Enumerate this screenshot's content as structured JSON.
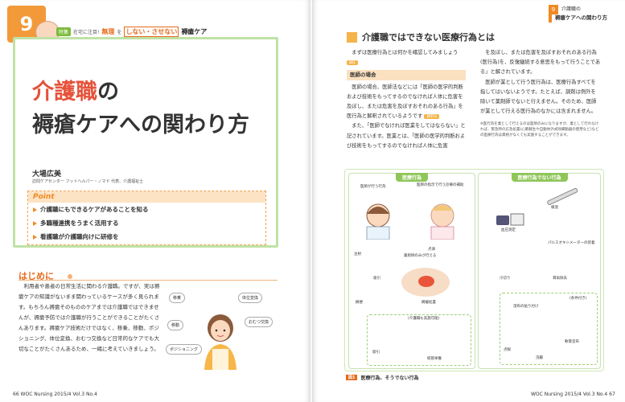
{
  "left": {
    "badge_number": "9",
    "topbar": {
      "tag": "特集",
      "small": "在宅に注目!",
      "em": "無理",
      "mid": "を",
      "u": "しない・させない",
      "main": "褥瘡ケア"
    },
    "title_line1_orange": "介護職",
    "title_line1_rest": "の",
    "title_line2": "褥瘡ケアへの関わり方",
    "author": "大場広美",
    "affiliation": "訪問ケアセンター フットヘルパー・ノマド 代表、介護福祉士",
    "point_header": "Point",
    "points": [
      "介護職にもできるケアがあることを知る",
      "多職種連携をうまく活用する",
      "看護職が介護職向けに研修を"
    ],
    "section_heading": "はじめに",
    "body": "利用者や患者の日常生活に関わる介護職。ですが、実は褥瘡ケアの知識がないまま関わっているケースが多く見られます。もちろん褥瘡そのもののケアまでは介護職ではできませんが、褥瘡予防では介護職が行うことができることがたくさんあります。褥瘡ケア技術だけではなく、移乗、移動、ポジショニング、体位変換、おむつ交換など日常的なケアでも大切なことがたくさんあるため、一緒に考えていきましょう。",
    "bubbles": [
      "移乗",
      "体位変換",
      "移動",
      "おむつ交換",
      "ポジショニング"
    ],
    "footer": "66   WOC Nursing  2015/4 Vol.3 No.4"
  },
  "right": {
    "tab_number": "9",
    "tab_line1": "介護職の",
    "tab_line2": "褥瘡ケアへの関わり方",
    "section_title": "介護職ではできない医療行為とは",
    "col1_p1": "まずは医療行為とは何かを確認してみましょう",
    "col1_tag1": "図1",
    "col1_subhead": "医師の場合",
    "col1_p2": "医師の場合、医師法などには「医師の医学的判断および技術をもってするのでなければ人体に危害を及ぼし、または危害を及ぼすおそれのある行為」を医行為と解釈されているようです",
    "col1_tag2": "資料1",
    "col1_p3": "また、「医師でなければ医業をしてはならない」と記されています。医業とは、「医師の医学的判断および技術をもってするのでなければ人体に危害",
    "col2_p1": "を及ぼし、または危害を及ぼすおそれのある行為(医行為)を、反復継続する意思をもって行うことである」と解されています。",
    "col2_p2": "医師が業として行う医行為は、医療行為すべてを指してはいないようです。たとえば、調剤は例外を除いて薬剤師でないと行えません。そのため、医師が業として行える医行為のなかには含まれません。",
    "col2_note": "※医行為を業として行えるのは医師のみになりますが、業として行わなければ、緊急時の応急処置(心肺蘇生や自動体外式除細動器の使用など)などの医療行為は資格がなくても実施することができます。",
    "figure": {
      "left_header": "医療行為",
      "right_header": "医療行為でない行為",
      "labels_left": [
        "医師が行う行為",
        "医師の指示で行う診療の補助",
        "薬剤師のみが行える",
        "摘便",
        "褥瘡処置",
        "吸引",
        "経管栄養",
        "(介護職も実施可能)",
        "点滴",
        "注射"
      ],
      "labels_right": [
        "検温",
        "血圧測定",
        "パルスオキシメーターの装着",
        "爪切り",
        "耳垢除去",
        "(条件付き)",
        "湿布の貼り付け",
        "点眼",
        "軟膏塗布",
        "浣腸"
      ],
      "caption_tag": "図1",
      "caption": "医療行為、そうでない行為"
    },
    "footer": "WOC Nursing  2015/4 Vol.3 No.4   67"
  }
}
